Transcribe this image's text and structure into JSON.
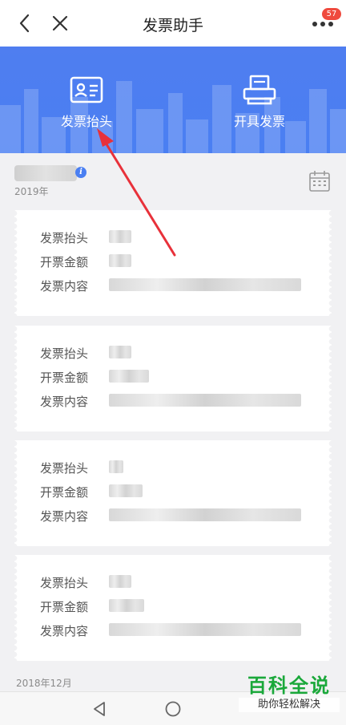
{
  "header": {
    "title": "发票助手",
    "badge": "57"
  },
  "banner": {
    "tiles": [
      {
        "label": "发票抬头",
        "icon": "id-card-icon"
      },
      {
        "label": "开具发票",
        "icon": "printer-icon"
      }
    ],
    "color": "#4a7ff2"
  },
  "section1": {
    "date": "2019年"
  },
  "cards": [
    {
      "r1": "发票抬头",
      "r2": "开票金额",
      "r3": "发票内容"
    },
    {
      "r1": "发票抬头",
      "r2": "开票金额",
      "r3": "发票内容"
    },
    {
      "r1": "发票抬头",
      "r2": "开票金额",
      "r3": "发票内容"
    },
    {
      "r1": "发票抬头",
      "r2": "开票金额",
      "r3": "发票内容"
    }
  ],
  "section2": {
    "date": "2018年12月"
  },
  "watermark": {
    "big": "百科全说",
    "small": "助你轻松解决"
  },
  "annotation": {
    "color": "#e8313a"
  }
}
